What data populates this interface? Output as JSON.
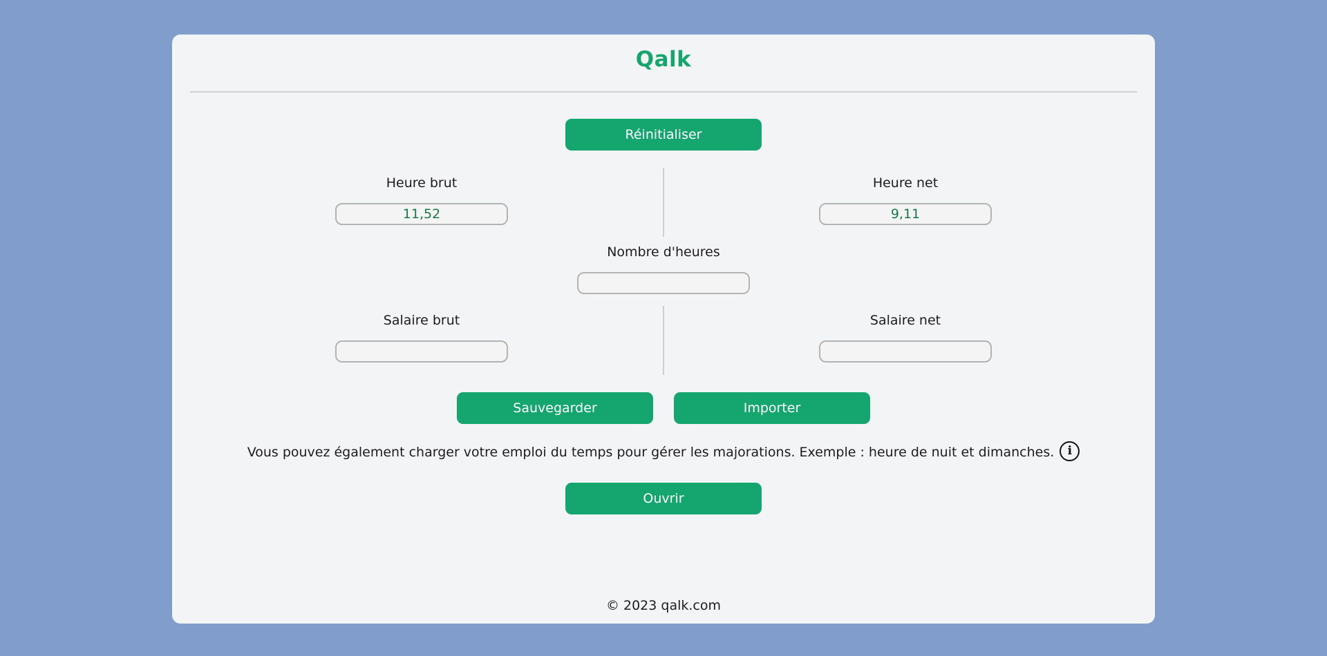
{
  "app": {
    "brand": "Qalk"
  },
  "buttons": {
    "reset": "Réinitialiser",
    "save": "Sauvegarder",
    "import": "Importer",
    "open": "Ouvrir"
  },
  "fields": {
    "heure_brut": {
      "label": "Heure brut",
      "value": "11,52"
    },
    "heure_net": {
      "label": "Heure net",
      "value": "9,11"
    },
    "nombre_heures": {
      "label": "Nombre d'heures",
      "value": ""
    },
    "salaire_brut": {
      "label": "Salaire brut",
      "value": ""
    },
    "salaire_net": {
      "label": "Salaire net",
      "value": ""
    }
  },
  "info": {
    "text": "Vous pouvez également charger votre emploi du temps pour gérer les majorations. Exemple : heure de nuit et dimanches.",
    "icon": "info-icon",
    "icon_glyph": "i"
  },
  "footer": {
    "copyright": "© 2023 qalk.com"
  },
  "colors": {
    "background": "#819dcb",
    "card": "#f3f4f6",
    "accent": "#15a56f",
    "value_text": "#157a4a"
  }
}
